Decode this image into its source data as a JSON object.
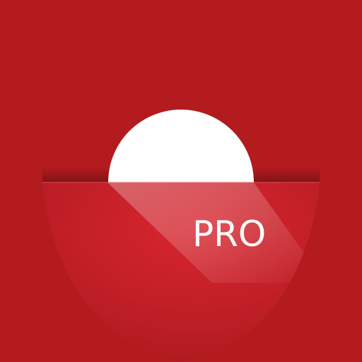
{
  "icon": {
    "badge_label": "PRO",
    "shapes": {
      "background": "background-square",
      "sun": "half-sun-icon",
      "pocket": "pocket-panel",
      "glare": "glare-highlight"
    },
    "colors": {
      "background": "#b31b1e",
      "pocket": "#c8202a",
      "pocket_highlight": "#e44a52",
      "sun": "#ffffff",
      "text": "#ffffff"
    }
  }
}
